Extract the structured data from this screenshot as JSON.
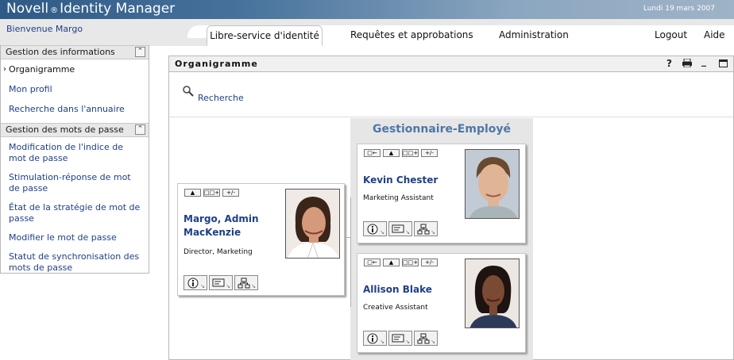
{
  "header": {
    "brand": "Novell",
    "brand_reg": "®",
    "product": "Identity Manager",
    "date": "Lundi 19 mars 2007",
    "welcome": "Bienvenue Margo"
  },
  "nav": {
    "tabs": [
      "Libre-service d'identité",
      "Requêtes et approbations",
      "Administration"
    ],
    "logout": "Logout",
    "help": "Aide"
  },
  "sidebar": {
    "sections": [
      {
        "title": "Gestion des informations",
        "items": [
          "Organigramme",
          "Mon profil",
          "Recherche dans l'annuaire"
        ]
      },
      {
        "title": "Gestion des mots de passe",
        "items": [
          "Modification de l'indice de mot de passe",
          "Stimulation-réponse de mot de passe",
          "État de la stratégie de mot de passe",
          "Modifier le mot de passe",
          "Statut de synchronisation des mots de passe"
        ]
      }
    ]
  },
  "portlet": {
    "title": "Organigramme",
    "search_label": "Recherche",
    "group_title": "Gestionnaire-Employé"
  },
  "people": {
    "manager": {
      "name": "Margo, Admin MacKenzie",
      "title": "Director, Marketing"
    },
    "employees": [
      {
        "name": "Kevin Chester",
        "title": "Marketing Assistant"
      },
      {
        "name": "Allison Blake",
        "title": "Creative Assistant"
      }
    ]
  },
  "icons": {
    "action_up": "up-arrow-icon",
    "action_expand": "hierarchy-expand-icon",
    "action_toggle": "+/-",
    "action_back": "back-arrow-icon"
  },
  "colors": {
    "link": "#1f3f87",
    "header_dark": "#2f5a86",
    "group_title": "#4e77a7"
  }
}
